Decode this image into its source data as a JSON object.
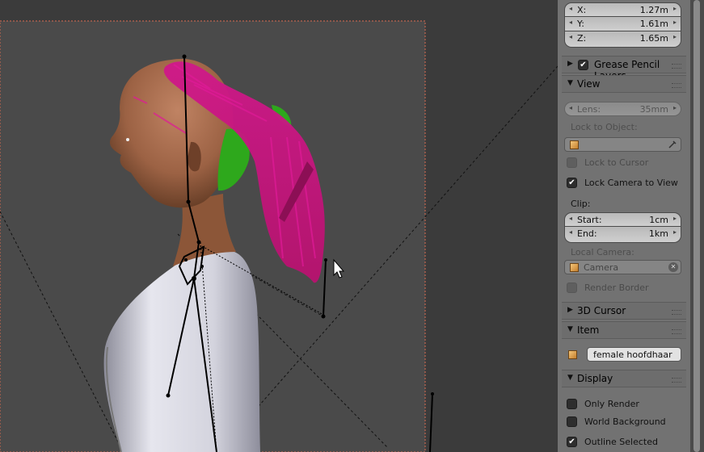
{
  "location": {
    "x": {
      "label": "X:",
      "value": "1.27m"
    },
    "y": {
      "label": "Y:",
      "value": "1.61m"
    },
    "z": {
      "label": "Z:",
      "value": "1.65m"
    }
  },
  "grease_pencil": {
    "title": "Grease Pencil Layers",
    "checked": true
  },
  "view": {
    "title": "View",
    "lens": {
      "label": "Lens:",
      "value": "35mm"
    },
    "lock_to_object_label": "Lock to Object:",
    "lock_to_cursor": {
      "label": "Lock to Cursor",
      "checked": false
    },
    "lock_camera_to_view": {
      "label": "Lock Camera to View",
      "checked": true
    },
    "clip_label": "Clip:",
    "clip_start": {
      "label": "Start:",
      "value": "1cm"
    },
    "clip_end": {
      "label": "End:",
      "value": "1km"
    },
    "local_camera_label": "Local Camera:",
    "local_camera_value": "Camera",
    "render_border": {
      "label": "Render Border",
      "checked": false
    }
  },
  "cursor_3d": {
    "title": "3D Cursor"
  },
  "item": {
    "title": "Item",
    "name": "female hoofdhaar"
  },
  "display": {
    "title": "Display",
    "only_render": {
      "label": "Only Render",
      "checked": false
    },
    "world_background": {
      "label": "World Background",
      "checked": false
    },
    "outline_selected": {
      "label": "Outline Selected",
      "checked": true
    }
  },
  "icons": {
    "expanded": "▼",
    "collapsed": "▶",
    "checkmark": "✔",
    "clear": "✕",
    "arrow_left": "◂",
    "arrow_right": "▸"
  },
  "colors": {
    "hair_magenta": "#c0137c",
    "hair_green": "#2ea81c",
    "skin": "#a3684a",
    "shirt": "#c9c9d6",
    "camera_frame": "#d86b50"
  }
}
